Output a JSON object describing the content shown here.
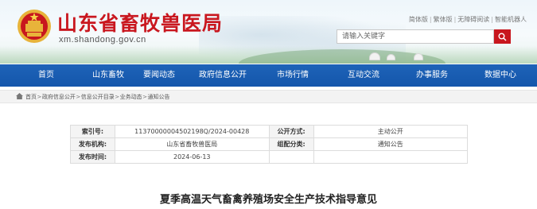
{
  "site": {
    "title": "山东省畜牧兽医局",
    "domain": "xm.shandong.gov.cn"
  },
  "top_links": [
    "简体版",
    "繁体版",
    "无障碍阅读",
    "智能机器人"
  ],
  "search": {
    "placeholder": "请输入关键字"
  },
  "nav": {
    "items": [
      "首页",
      "山东畜牧",
      "要闻动态",
      "政府信息公开",
      "市场行情",
      "互动交流",
      "办事服务",
      "数据中心"
    ]
  },
  "breadcrumb": {
    "items": [
      "首页",
      "政府信息公开",
      "信息公开目录",
      "业务动态",
      "通知公告"
    ],
    "separator": ">"
  },
  "info": {
    "index_label": "索引号:",
    "index_value": "11370000004502198Q/2024-00428",
    "public_mode_label": "公开方式:",
    "public_mode_value": "主动公开",
    "publisher_label": "发布机构:",
    "publisher_value": "山东省畜牧兽医局",
    "category_label": "组配分类:",
    "category_value": "通知公告",
    "date_label": "发布时间:",
    "date_value": "2024-06-13"
  },
  "article": {
    "title": "夏季高温天气畜禽养殖场安全生产技术指导意见"
  },
  "colors": {
    "brand_red": "#c9171f",
    "nav_blue": "#1a5db3"
  },
  "icons": {
    "emblem": "national-emblem-icon",
    "search": "search-icon",
    "home": "home-icon"
  }
}
